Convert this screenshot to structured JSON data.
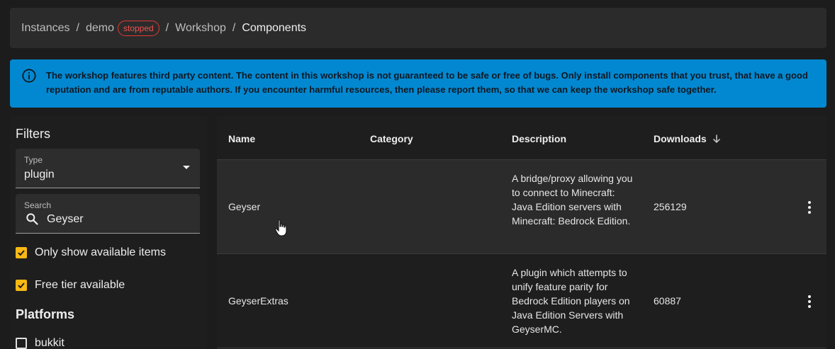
{
  "breadcrumb": {
    "items": [
      "Instances",
      "demo",
      "Workshop",
      "Components"
    ],
    "separator": "/",
    "status_badge": "stopped"
  },
  "banner": {
    "icon": "info-icon",
    "text": "The workshop features third party content. The content in this workshop is not guaranteed to be safe or free of bugs. Only install components that you trust, that have a good reputation and are from reputable authors. If you encounter harmful resources, then please report them, so that we can keep the workshop safe together."
  },
  "filters": {
    "title": "Filters",
    "type_label": "Type",
    "type_value": "plugin",
    "search_label": "Search",
    "search_value": "Geyser",
    "only_available_label": "Only show available items",
    "only_available_checked": true,
    "free_tier_label": "Free tier available",
    "free_tier_checked": true,
    "platforms_title": "Platforms",
    "platforms": [
      {
        "label": "bukkit",
        "checked": false
      }
    ]
  },
  "table": {
    "columns": {
      "name": "Name",
      "category": "Category",
      "description": "Description",
      "downloads": "Downloads"
    },
    "sort_icon": "arrow-down-icon",
    "rows": [
      {
        "name": "Geyser",
        "category": "",
        "description": "A bridge/proxy allowing you to connect to Minecraft: Java Edition servers with Minecraft: Bedrock Edition.",
        "downloads": "256129"
      },
      {
        "name": "GeyserExtras",
        "category": "",
        "description": "A plugin which attempts to unify feature parity for Bedrock Edition players on Java Edition Servers with GeyserMC.",
        "downloads": "60887"
      }
    ]
  },
  "colors": {
    "accent": "#f9b814",
    "banner": "#0288d1",
    "status": "#e53935"
  }
}
